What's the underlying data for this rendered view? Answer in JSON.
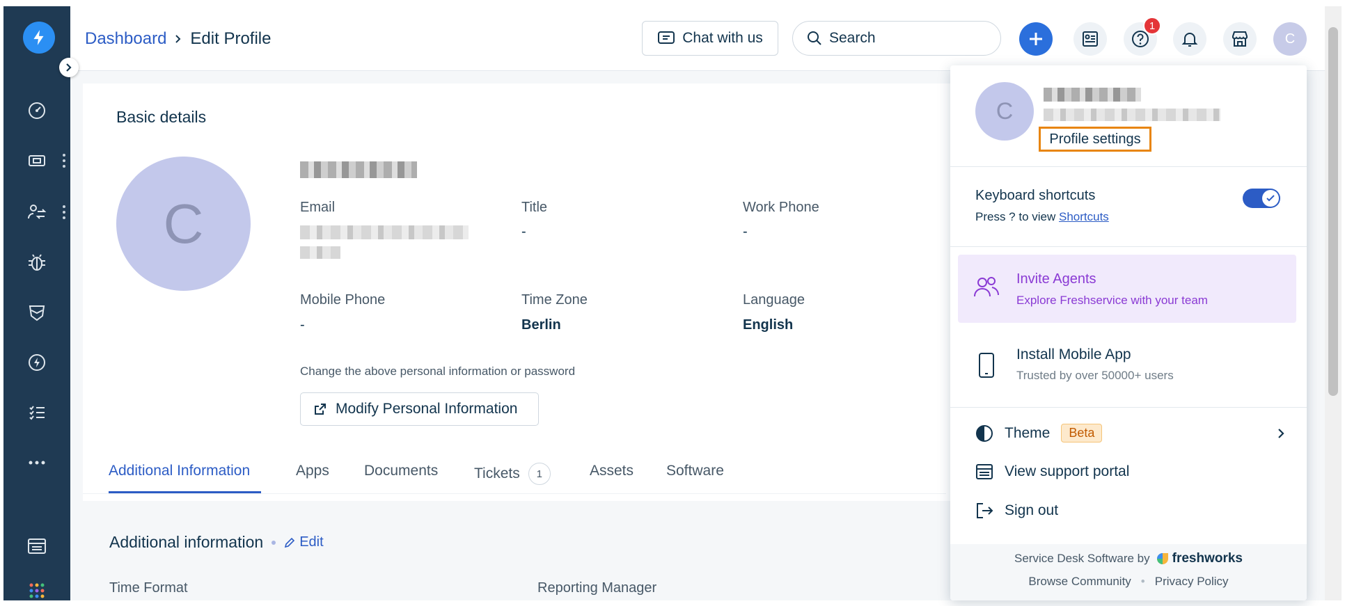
{
  "breadcrumb": {
    "root": "Dashboard",
    "separator": ">",
    "current": "Edit Profile"
  },
  "header": {
    "chat_label": "Chat with us",
    "search_placeholder": "Search",
    "help_badge": "1",
    "avatar_initial": "C"
  },
  "sidebar": {
    "items": [
      "dashboard-icon",
      "tickets-icon",
      "changes-icon",
      "problems-icon",
      "releases-icon",
      "automation-icon",
      "tasks-icon",
      "more-icon",
      "portal-icon",
      "apps-grid-icon"
    ]
  },
  "profile": {
    "section_title": "Basic details",
    "avatar_initial": "C",
    "fields": {
      "email_label": "Email",
      "title_label": "Title",
      "title_value": "-",
      "work_phone_label": "Work Phone",
      "work_phone_value": "-",
      "mobile_label": "Mobile Phone",
      "mobile_value": "-",
      "timezone_label": "Time Zone",
      "timezone_value": "Berlin",
      "language_label": "Language",
      "language_value": "English"
    },
    "hint": "Change the above personal information or password",
    "modify_label": "Modify Personal Information"
  },
  "tabs": [
    {
      "label": "Additional Information"
    },
    {
      "label": "Apps"
    },
    {
      "label": "Documents"
    },
    {
      "label": "Tickets",
      "count": "1"
    },
    {
      "label": "Assets"
    },
    {
      "label": "Software"
    }
  ],
  "additional": {
    "title": "Additional information",
    "edit_label": "Edit",
    "time_format_label": "Time Format",
    "reporting_manager_label": "Reporting Manager"
  },
  "dropdown": {
    "avatar_initial": "C",
    "profile_settings": "Profile settings",
    "shortcuts_title": "Keyboard shortcuts",
    "shortcuts_hint": "Press ? to view",
    "shortcuts_link": "Shortcuts",
    "shortcuts_enabled": true,
    "invite_title": "Invite Agents",
    "invite_sub": "Explore Freshservice with your team",
    "mobile_title": "Install Mobile App",
    "mobile_sub": "Trusted by over 50000+ users",
    "theme_label": "Theme",
    "theme_badge": "Beta",
    "portal_label": "View support portal",
    "signout_label": "Sign out",
    "footer_text": "Service Desk Software by",
    "footer_brand": "freshworks",
    "community_link": "Browse Community",
    "footer_sep": "•",
    "privacy_link": "Privacy Policy"
  },
  "colors": {
    "sidebar": "#1f3a53",
    "accent": "#2c5cc5",
    "highlight": "#e8850f",
    "invite_bg": "#f1eafc"
  }
}
